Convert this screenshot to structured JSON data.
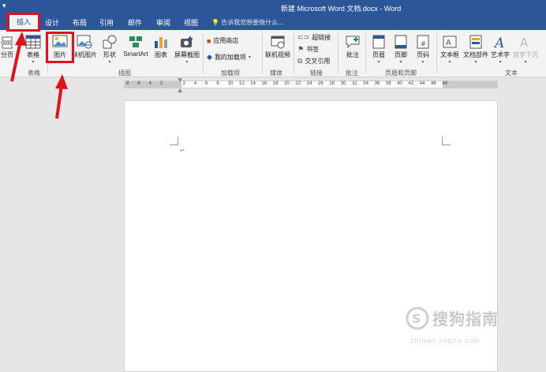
{
  "window": {
    "quick_access": "▾",
    "title": "新建 Microsoft Word 文档.docx - Word",
    "tell_me": "告诉我您想要做什么..."
  },
  "tabs": [
    "插入",
    "设计",
    "布局",
    "引用",
    "邮件",
    "审阅",
    "视图"
  ],
  "ribbon": {
    "groups": [
      {
        "label": "表格"
      },
      {
        "label": "插图"
      },
      {
        "label": "加载项"
      },
      {
        "label": "媒体"
      },
      {
        "label": "链接"
      },
      {
        "label": "批注"
      },
      {
        "label": "页眉和页脚"
      },
      {
        "label": "文本"
      }
    ],
    "buttons": {
      "page_break": "分页",
      "table": "表格",
      "picture": "图片",
      "online_picture": "联机图片",
      "shapes": "形状",
      "smartart": "SmartArt",
      "chart": "图表",
      "screenshot": "屏幕截图",
      "app_store": "应用商店",
      "my_addins": "我的加载项",
      "online_video": "联机视频",
      "hyperlink": "超链接",
      "bookmark": "书签",
      "cross_reference": "交叉引用",
      "comment": "批注",
      "header": "页眉",
      "footer": "页脚",
      "page_number": "页码",
      "text_box": "文本框",
      "quick_parts": "文档部件",
      "wordart": "艺术字",
      "drop_cap": "首字下沉"
    }
  },
  "ruler": {
    "ticks": [
      "8",
      "6",
      "4",
      "2",
      "",
      "2",
      "4",
      "6",
      "8",
      "10",
      "12",
      "14",
      "16",
      "18",
      "20",
      "22",
      "24",
      "26",
      "28",
      "30",
      "32",
      "34",
      "36",
      "38",
      "40",
      "42",
      "44",
      "46",
      "48"
    ]
  },
  "document": {
    "paragraph_mark": "↵"
  },
  "watermark": {
    "text": "搜狗指南",
    "domain": "zhinan.sogou.com"
  },
  "colors": {
    "accent": "#2b579a",
    "highlight": "#e0121e"
  }
}
